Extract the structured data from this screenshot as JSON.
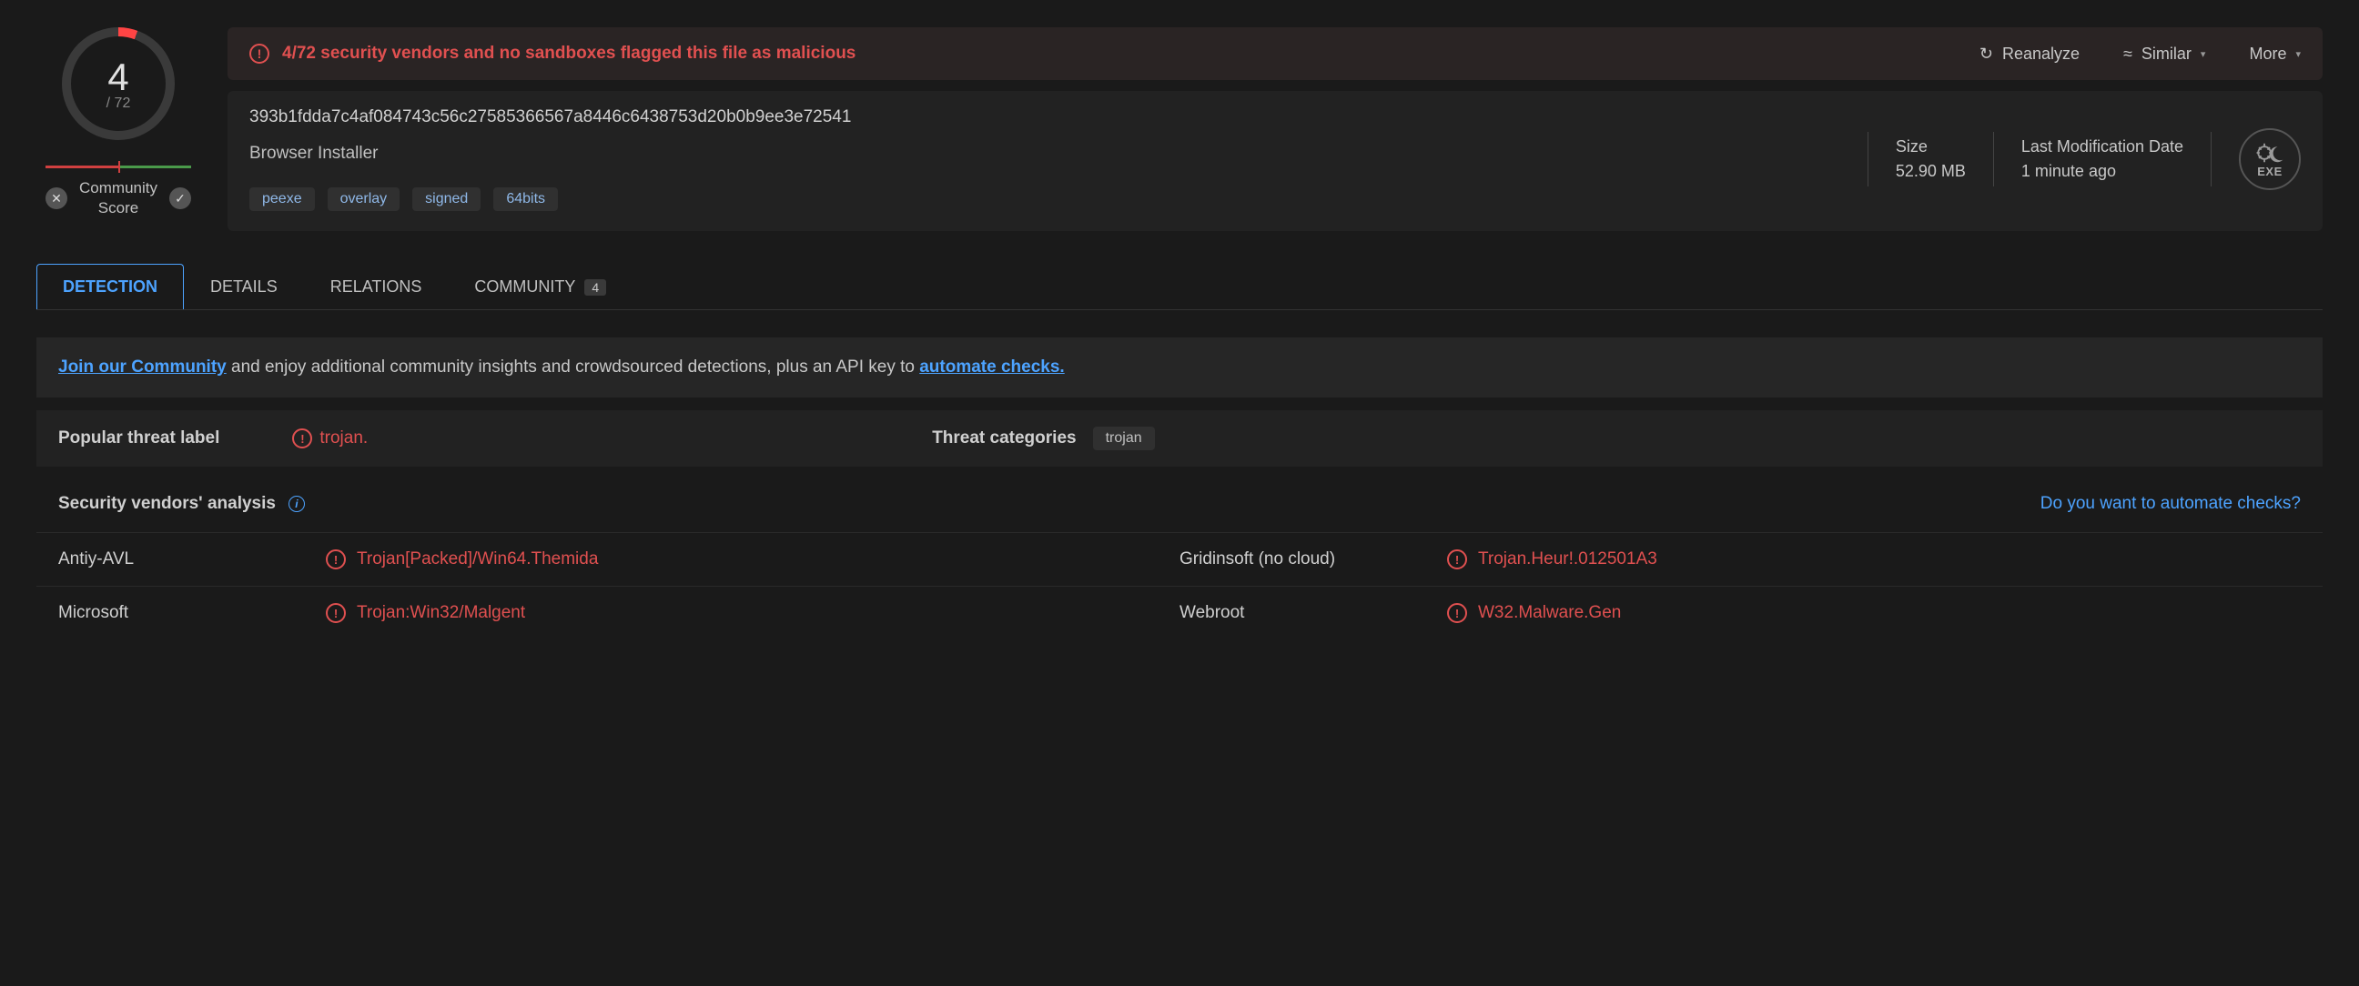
{
  "score": {
    "detected": "4",
    "total": "/ 72"
  },
  "community_score_label_1": "Community",
  "community_score_label_2": "Score",
  "banner": {
    "text": "4/72 security vendors and no sandboxes flagged this file as malicious",
    "reanalyze": "Reanalyze",
    "similar": "Similar",
    "more": "More"
  },
  "file": {
    "hash": "393b1fdda7c4af084743c56c27585366567a8446c6438753d20b0b9ee3e72541",
    "name": "Browser Installer",
    "tags": [
      "peexe",
      "overlay",
      "signed",
      "64bits"
    ],
    "size_label": "Size",
    "size_value": "52.90 MB",
    "mod_label": "Last Modification Date",
    "mod_value": "1 minute ago",
    "exe_label": "EXE"
  },
  "tabs": {
    "detection": "DETECTION",
    "details": "DETAILS",
    "relations": "RELATIONS",
    "community": "COMMUNITY",
    "community_count": "4"
  },
  "promo": {
    "join": "Join our Community",
    "mid": " and enjoy additional community insights and crowdsourced detections, plus an API key to ",
    "auto": "automate checks."
  },
  "threat": {
    "popular_label": "Popular threat label",
    "popular_value": "trojan.",
    "categories_label": "Threat categories",
    "categories": [
      "trojan"
    ]
  },
  "analysis": {
    "title": "Security vendors' analysis",
    "auto_link": "Do you want to automate checks?"
  },
  "vendors": [
    {
      "name": "Antiy-AVL",
      "detection": "Trojan[Packed]/Win64.Themida"
    },
    {
      "name": "Gridinsoft (no cloud)",
      "detection": "Trojan.Heur!.012501A3"
    },
    {
      "name": "Microsoft",
      "detection": "Trojan:Win32/Malgent"
    },
    {
      "name": "Webroot",
      "detection": "W32.Malware.Gen"
    }
  ]
}
